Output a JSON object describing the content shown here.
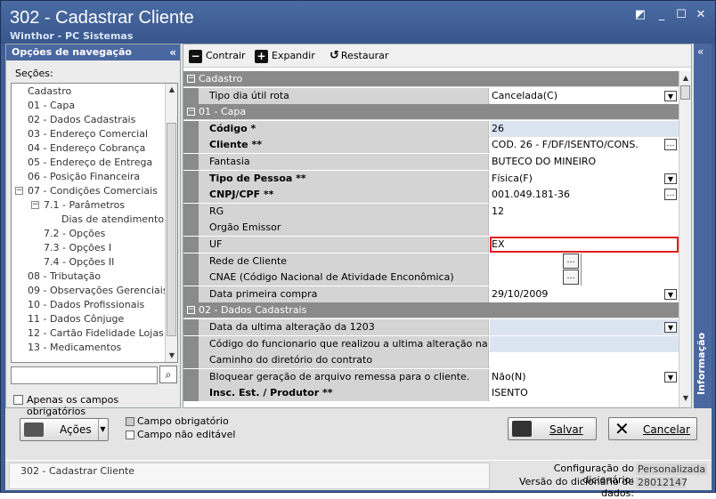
{
  "window": {
    "title": "302 - Cadastrar Cliente",
    "subtitle": "Winthor - PC Sistemas"
  },
  "nav": {
    "header": "Opções de navegação",
    "sections_label": "Seções:",
    "tree": [
      {
        "label": "Cadastro",
        "indent": 0
      },
      {
        "label": "01 - Capa",
        "indent": 0
      },
      {
        "label": "02 - Dados Cadastrais",
        "indent": 0
      },
      {
        "label": "03 - Endereço Comercial",
        "indent": 0
      },
      {
        "label": "04 - Endereço Cobrança",
        "indent": 0
      },
      {
        "label": "05 - Endereço de Entrega",
        "indent": 0
      },
      {
        "label": "06 - Posição Financeira",
        "indent": 0
      },
      {
        "label": "07 - Condições Comerciais",
        "indent": 0,
        "expander": "−"
      },
      {
        "label": "7.1 - Parâmetros",
        "indent": 1,
        "expander": "−"
      },
      {
        "label": "Dias de atendimento",
        "indent": 2
      },
      {
        "label": "7.2 - Opções",
        "indent": 1
      },
      {
        "label": "7.3 - Opções I",
        "indent": 1
      },
      {
        "label": "7.4 - Opções II",
        "indent": 1
      },
      {
        "label": "08 - Tributação",
        "indent": 0
      },
      {
        "label": "09 - Observações Gerenciais",
        "indent": 0
      },
      {
        "label": "10 - Dados Profissionais",
        "indent": 0
      },
      {
        "label": "11 - Dados Cônjuge",
        "indent": 0
      },
      {
        "label": "12 - Cartão Fidelidade Lojas",
        "indent": 0
      },
      {
        "label": "13 - Medicamentos",
        "indent": 0
      }
    ],
    "required_only_label": "Apenas os campos obrigatórios"
  },
  "toolbar": {
    "collapse": "Contrair",
    "expand": "Expandir",
    "restore": "Restaurar"
  },
  "grid": [
    {
      "type": "section",
      "label": "Cadastro"
    },
    {
      "type": "field",
      "label": "Tipo dia útil rota",
      "value": "Cancelada(C)",
      "editor": "dropdown"
    },
    {
      "type": "section",
      "label": "01 - Capa"
    },
    {
      "type": "field",
      "label": "Código *",
      "value": "26",
      "bold": true,
      "readonly": true
    },
    {
      "type": "field",
      "label": "Cliente **",
      "value": "COD. 26 - F/DF/ISENTO/CONS.",
      "bold": true,
      "editor": "ellipsis"
    },
    {
      "type": "field",
      "label": "Fantasia",
      "value": "BUTECO DO MINEIRO"
    },
    {
      "type": "field",
      "label": "Tipo de Pessoa **",
      "value": "Física(F)",
      "bold": true,
      "editor": "dropdown"
    },
    {
      "type": "field",
      "label": "CNPJ/CPF **",
      "value": "001.049.181-36",
      "bold": true,
      "editor": "ellipsis"
    },
    {
      "type": "field",
      "label": "RG",
      "value": "12"
    },
    {
      "type": "field",
      "label": "Orgão Emissor",
      "value": ""
    },
    {
      "type": "field",
      "label": "UF",
      "value": "EX",
      "highlight": true
    },
    {
      "type": "field",
      "label": "Rede de Cliente",
      "value": "",
      "editor": "split"
    },
    {
      "type": "field",
      "label": "CNAE (Código Nacional de Atividade Enconômica)",
      "value": "",
      "editor": "split"
    },
    {
      "type": "field",
      "label": "Data primeira compra",
      "value": "29/10/2009",
      "editor": "dropdown"
    },
    {
      "type": "section",
      "label": "02 - Dados Cadastrais"
    },
    {
      "type": "field",
      "label": "Data da ultima alteração da 1203",
      "value": "",
      "readonly": true,
      "editor": "dropdown"
    },
    {
      "type": "field",
      "label": "Código do funcionario que realizou a ultima alteração na 1203",
      "value": "",
      "readonly": true
    },
    {
      "type": "field",
      "label": "Caminho do diretório do contrato",
      "value": ""
    },
    {
      "type": "field",
      "label": "Bloquear geração de arquivo remessa para o cliente.",
      "value": "Não(N)",
      "editor": "dropdown"
    },
    {
      "type": "field",
      "label": "Insc. Est. / Produtor **",
      "value": "ISENTO",
      "bold": true
    }
  ],
  "info_panel": {
    "label": "Informação"
  },
  "footer": {
    "actions_label": "Ações",
    "legend_required": "Campo obrigatório",
    "legend_not_editable": "Campo não editável",
    "save_label": "Salvar",
    "cancel_label": "Cancelar"
  },
  "status": {
    "left": "302 - Cadastrar Cliente",
    "dict_config_label": "Configuração do dicionário:",
    "dict_config_value": "Personalizada",
    "dict_version_label": "Versão do dicionário de dados:",
    "dict_version_value": "28012147"
  }
}
